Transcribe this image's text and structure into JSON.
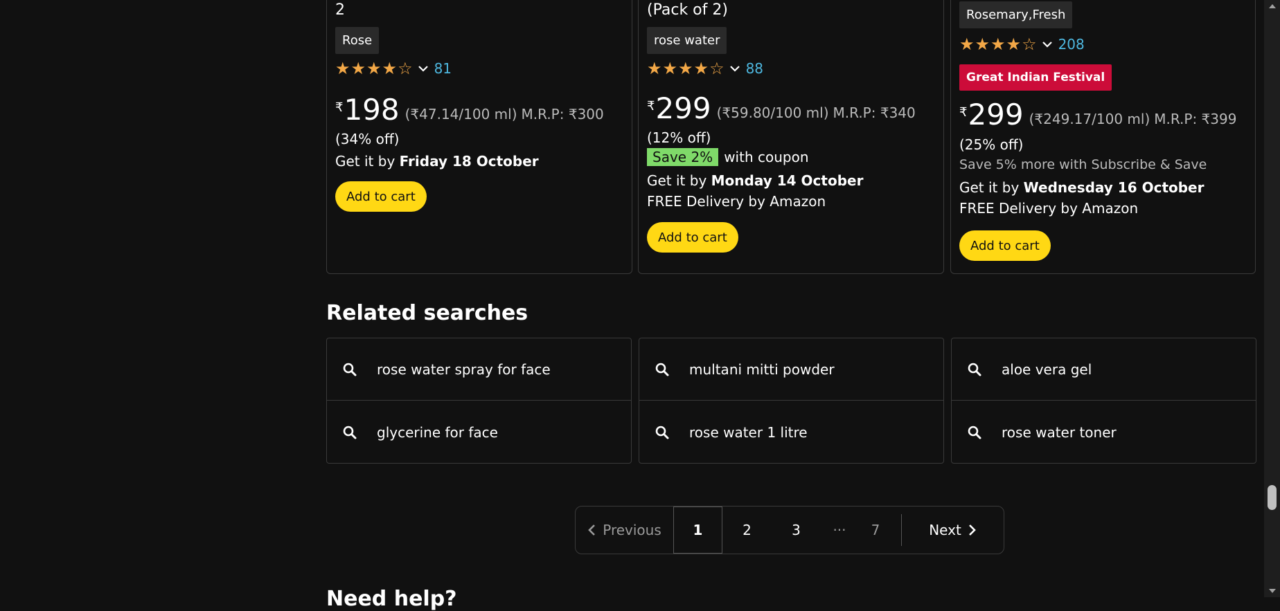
{
  "products": [
    {
      "title_tail": "2",
      "variant": "Rose",
      "stars_text": "★★★★☆",
      "review_count": "81",
      "rupee": "₹",
      "price": "198",
      "unit_price": "(₹47.14/100 ml)",
      "mrp": "M.R.P: ₹300",
      "discount": "(34% off)",
      "delivery_prefix": "Get it by ",
      "delivery_date": "Friday 18 October",
      "cart_label": "Add to cart"
    },
    {
      "title_tail": "(Pack of 2)",
      "variant": "rose water",
      "stars_text": "★★★★☆",
      "review_count": "88",
      "rupee": "₹",
      "price": "299",
      "unit_price": "(₹59.80/100 ml)",
      "mrp": "M.R.P: ₹340",
      "discount": "(12% off)",
      "coupon_badge": "Save 2%",
      "coupon_text": "with coupon",
      "delivery_prefix": "Get it by ",
      "delivery_date": "Monday 14 October",
      "free_delivery": "FREE Delivery by Amazon",
      "cart_label": "Add to cart"
    },
    {
      "variant": "Rosemary,Fresh",
      "stars_text": "★★★★☆",
      "review_count": "208",
      "deal_badge": "Great Indian Festival",
      "rupee": "₹",
      "price": "299",
      "unit_price": "(₹249.17/100 ml)",
      "mrp": "M.R.P: ₹399",
      "discount": "(25% off)",
      "subscribe_save": "Save 5% more with Subscribe & Save",
      "delivery_prefix": "Get it by ",
      "delivery_date": "Wednesday 16 October",
      "free_delivery": "FREE Delivery by Amazon",
      "cart_label": "Add to cart"
    }
  ],
  "related": {
    "heading": "Related searches",
    "items": [
      "rose water spray for face",
      "glycerine for face",
      "multani mitti powder",
      "rose water 1 litre",
      "aloe vera gel",
      "rose water toner"
    ]
  },
  "pagination": {
    "previous": "Previous",
    "pages": [
      "1",
      "2",
      "3"
    ],
    "ellipsis": "···",
    "last": "7",
    "next": "Next",
    "current": "1"
  },
  "next_section_heading": "Need help?",
  "colors": {
    "background": "#111111",
    "star": "#f3a847",
    "link": "#4eb8e0",
    "cart_button": "#ffd814",
    "deal_badge": "#cc0c39",
    "coupon_badge": "#7fda69"
  }
}
